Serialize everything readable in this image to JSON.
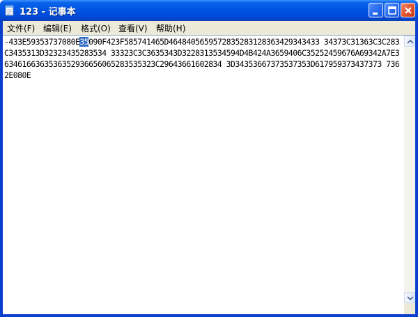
{
  "window": {
    "title": "123 - 记事本"
  },
  "menu": [
    "文件(F)",
    "编辑(E)",
    "格式(O)",
    "查看(V)",
    "帮助(H)"
  ],
  "document": {
    "text_before": "-433E59353737080E",
    "selected": "35",
    "text_after": "090F423F585741465D4648405659572835283128363429343433 34373C31363C3C283C3435313D32323435283534 33323C3C3635343D3228313534594D4B424A3659406C35252459676A69342A7E36346166363536352936656065283535323C29643661602834 3D34353667373537353D617959373437373 7362E080E"
  },
  "colors": {
    "title_bar": "#0055e5",
    "selection": "#316ac5",
    "menu_bg": "#ece9d8"
  },
  "icons": [
    "notepad-icon",
    "minimize-icon",
    "maximize-icon",
    "close-icon",
    "scroll-up-icon",
    "scroll-down-icon"
  ]
}
